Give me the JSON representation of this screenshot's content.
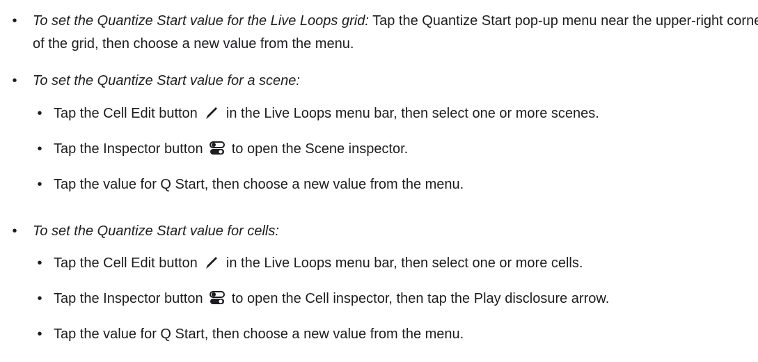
{
  "items": [
    {
      "lead": "To set the Quantize Start value for the Live Loops grid:",
      "text": " Tap the Quantize Start pop-up menu near the upper-right corner of the grid, then choose a new value from the menu."
    },
    {
      "lead": "To set the Quantize Start value for a scene:",
      "steps": [
        {
          "before": "Tap the Cell Edit button ",
          "icon": "pencil-icon",
          "after": " in the Live Loops menu bar, then select one or more scenes."
        },
        {
          "before": "Tap the Inspector button ",
          "icon": "inspector-toggle-icon",
          "after": " to open the Scene inspector."
        },
        {
          "before": "Tap the value for Q Start, then choose a new value from the menu.",
          "icon": "",
          "after": ""
        }
      ]
    },
    {
      "lead": "To set the Quantize Start value for cells:",
      "steps": [
        {
          "before": "Tap the Cell Edit button ",
          "icon": "pencil-icon",
          "after": " in the Live Loops menu bar, then select one or more cells."
        },
        {
          "before": "Tap the Inspector button ",
          "icon": "inspector-toggle-icon",
          "after": " to open the Cell inspector, then tap the Play disclosure arrow."
        },
        {
          "before": "Tap the value for Q Start, then choose a new value from the menu.",
          "icon": "",
          "after": ""
        }
      ]
    }
  ],
  "bullet_char": "•"
}
